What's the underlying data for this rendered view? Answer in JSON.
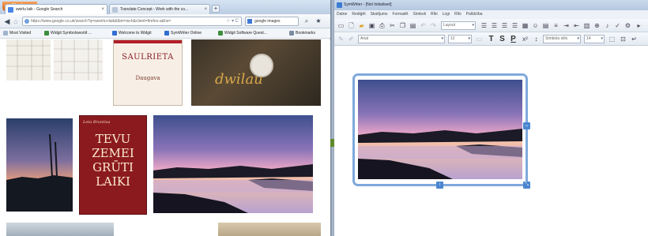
{
  "browser": {
    "menu_button": "Firefox",
    "tabs": [
      {
        "label": "swirlu laik - Google Search",
        "active": true,
        "favicon": "google-icon"
      },
      {
        "label": "Translate Concept - Work with the co...",
        "active": false,
        "favicon": "page-icon"
      }
    ],
    "address": "https://www.google.co.uk/search?q=sweirlu+laik&tbm=isch&client=firefox-a&hs=",
    "search_value": "google images",
    "bookmarks": [
      "Most Visited",
      "Widgit Symbolsworld ...",
      "Welcome to Widgit",
      "SymWriter Online",
      "Widgit Software Quest...",
      "Bookmarks"
    ],
    "images": {
      "tile_saulrieta_title": "SAULRIETA",
      "tile_saulrieta_author": "Daugava",
      "tile_signature_text": "dwilau",
      "tile_book_author": "Leta Bruntisa",
      "tile_book_lines": [
        "TEVU",
        "ZEMEI",
        "GRŪTI",
        "LAIKI"
      ]
    }
  },
  "symwriter": {
    "title": "SymWriter - [Not Initialised]",
    "menu": [
      "Datne",
      "Rediģēt",
      "Skatījums",
      "Formatēt",
      "Simboli",
      "Rīki",
      "Logi",
      "Rīki",
      "Palīdzība"
    ],
    "layout_combo": "Layout",
    "font_combo": "Arial",
    "size_combo": "12",
    "style_combo": "Simbola stils",
    "small_size_combo": "14",
    "text_style_buttons": [
      "T",
      "S",
      "P"
    ]
  },
  "colors": {
    "firefox_orange": "#e07528",
    "frame_blue": "#7fa9dc",
    "book_red": "#8b1a1f"
  }
}
